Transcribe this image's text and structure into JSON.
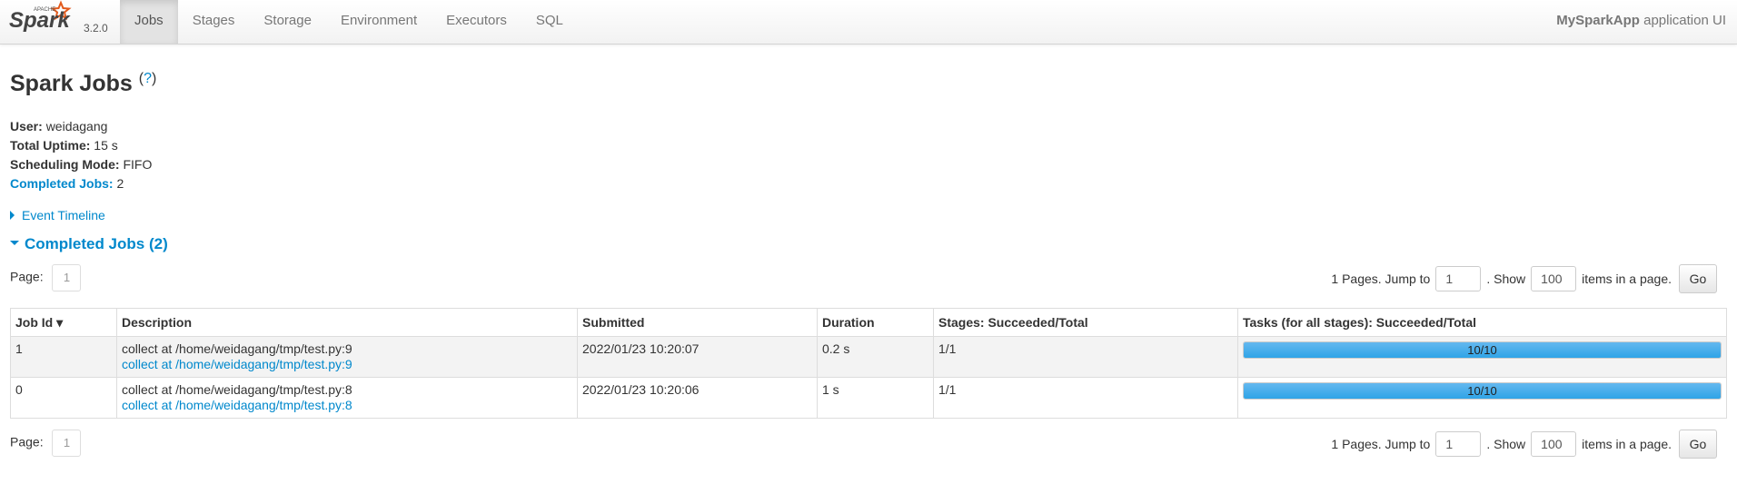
{
  "brand": {
    "apache": "APACHE",
    "name": "Spark",
    "version": "3.2.0"
  },
  "nav": {
    "items": [
      {
        "label": "Jobs",
        "active": true
      },
      {
        "label": "Stages"
      },
      {
        "label": "Storage"
      },
      {
        "label": "Environment"
      },
      {
        "label": "Executors"
      },
      {
        "label": "SQL"
      }
    ]
  },
  "app": {
    "name": "MySparkApp",
    "suffix": " application UI"
  },
  "page": {
    "title": "Spark Jobs",
    "help_open": "(",
    "help_mark": "?",
    "help_close": ")"
  },
  "info": {
    "user_label": "User:",
    "user_value": "weidagang",
    "uptime_label": "Total Uptime:",
    "uptime_value": "15 s",
    "mode_label": "Scheduling Mode:",
    "mode_value": "FIFO",
    "completed_label": "Completed Jobs:",
    "completed_value": "2"
  },
  "timeline": {
    "label": "Event Timeline"
  },
  "section": {
    "title": "Completed Jobs (2)"
  },
  "pager": {
    "page_label": "Page:",
    "page_number": "1",
    "pages_text": "1 Pages. Jump to",
    "jump_value": "1",
    "show_text": ". Show",
    "show_value": "100",
    "items_text": "items in a page.",
    "go_label": "Go"
  },
  "table": {
    "headers": [
      "Job Id ▾",
      "Description",
      "Submitted",
      "Duration",
      "Stages: Succeeded/Total",
      "Tasks (for all stages): Succeeded/Total"
    ],
    "rows": [
      {
        "id": "1",
        "desc": "collect at /home/weidagang/tmp/test.py:9",
        "desc_link": "collect at /home/weidagang/tmp/test.py:9",
        "submitted": "2022/01/23 10:20:07",
        "duration": "0.2 s",
        "stages": "1/1",
        "tasks": "10/10",
        "progress": 1.0
      },
      {
        "id": "0",
        "desc": "collect at /home/weidagang/tmp/test.py:8",
        "desc_link": "collect at /home/weidagang/tmp/test.py:8",
        "submitted": "2022/01/23 10:20:06",
        "duration": "1 s",
        "stages": "1/1",
        "tasks": "10/10",
        "progress": 1.0
      }
    ]
  },
  "colors": {
    "link": "#0088cc",
    "progress": "#2fa4e7",
    "brand_orange": "#e25a1c"
  }
}
